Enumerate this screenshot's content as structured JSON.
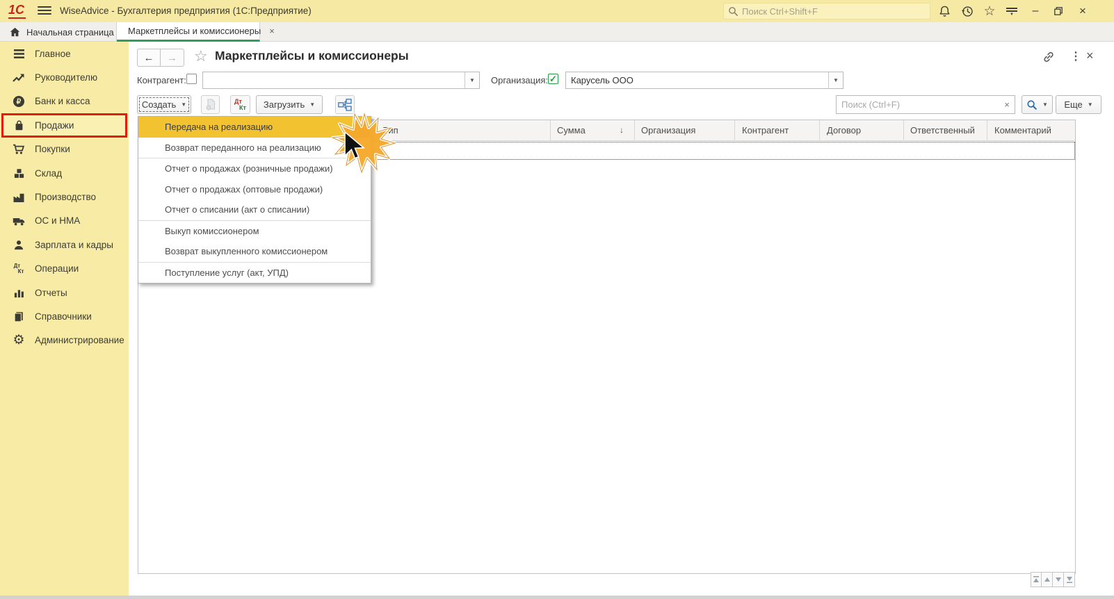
{
  "titlebar": {
    "logo_text": "1С",
    "title": "WiseAdvice - Бухгалтерия предприятия  (1С:Предприятие)",
    "search_placeholder": "Поиск Ctrl+Shift+F"
  },
  "tabs": {
    "home_label": "Начальная страница",
    "active_label": "Маркетплейсы и комиссионеры"
  },
  "sidebar": {
    "items": [
      {
        "label": "Главное",
        "icon": "menu-icon",
        "highlighted": false
      },
      {
        "label": "Руководителю",
        "icon": "trend-icon",
        "highlighted": false
      },
      {
        "label": "Банк и касса",
        "icon": "ruble-icon",
        "highlighted": false
      },
      {
        "label": "Продажи",
        "icon": "bag-icon",
        "highlighted": true
      },
      {
        "label": "Покупки",
        "icon": "cart-icon",
        "highlighted": false
      },
      {
        "label": "Склад",
        "icon": "boxes-icon",
        "highlighted": false
      },
      {
        "label": "Производство",
        "icon": "factory-icon",
        "highlighted": false
      },
      {
        "label": "ОС и НМА",
        "icon": "truck-icon",
        "highlighted": false
      },
      {
        "label": "Зарплата и кадры",
        "icon": "person-icon",
        "highlighted": false
      },
      {
        "label": "Операции",
        "icon": "dtkt-icon",
        "highlighted": false
      },
      {
        "label": "Отчеты",
        "icon": "barchart-icon",
        "highlighted": false
      },
      {
        "label": "Справочники",
        "icon": "books-icon",
        "highlighted": false
      },
      {
        "label": "Администрирование",
        "icon": "gear-icon",
        "highlighted": false
      }
    ],
    "colors": {
      "background": "#f8eba6",
      "highlight_border": "#e11d10"
    }
  },
  "page": {
    "title": "Маркетплейсы и комиссионеры",
    "filters": {
      "counterparty_label": "Контрагент:",
      "counterparty_checked": false,
      "counterparty_value": "",
      "organization_label": "Организация:",
      "organization_checked": true,
      "organization_value": "Карусель ООО"
    },
    "toolbar": {
      "create_label": "Создать",
      "load_label": "Загрузить",
      "search_placeholder": "Поиск (Ctrl+F)",
      "more_label": "Еще"
    },
    "create_menu": {
      "highlight_color": "#f2c230",
      "highlighted_item": "Передача на реализацию",
      "groups": [
        {
          "items": [
            "Передача на реализацию",
            "Возврат переданного на реализацию"
          ]
        },
        {
          "items": [
            "Отчет о продажах (розничные продажи)",
            "Отчет о продажах (оптовые продажи)",
            "Отчет о списании (акт о списании)"
          ]
        },
        {
          "items": [
            "Выкуп комиссионером",
            "Возврат выкупленного комиссионером"
          ]
        },
        {
          "items": [
            "Поступление услуг (акт, УПД)"
          ]
        }
      ]
    },
    "table": {
      "columns": [
        "Тип",
        "Сумма",
        "Организация",
        "Контрагент",
        "Договор",
        "Ответственный",
        "Комментарий"
      ],
      "sort": {
        "column": "Сумма",
        "direction": "desc"
      },
      "rows": []
    }
  },
  "dtkt": {
    "dt": "Дт",
    "kt": "Кт"
  },
  "icons": {
    "back": "←",
    "forward": "→",
    "star": "☆",
    "dots": "⋮",
    "close": "×",
    "caret": "▼",
    "sort_desc": "↓",
    "clear": "×",
    "check": "✓",
    "minimize": "–",
    "gear": "⚙"
  },
  "colors": {
    "titlebar": "#f6e9a4",
    "tab_active_underline": "#2f9e5d",
    "menu_highlight": "#f2c230",
    "accent_blue": "#2f6da8",
    "sidebar_highlight_border": "#e11d10"
  }
}
